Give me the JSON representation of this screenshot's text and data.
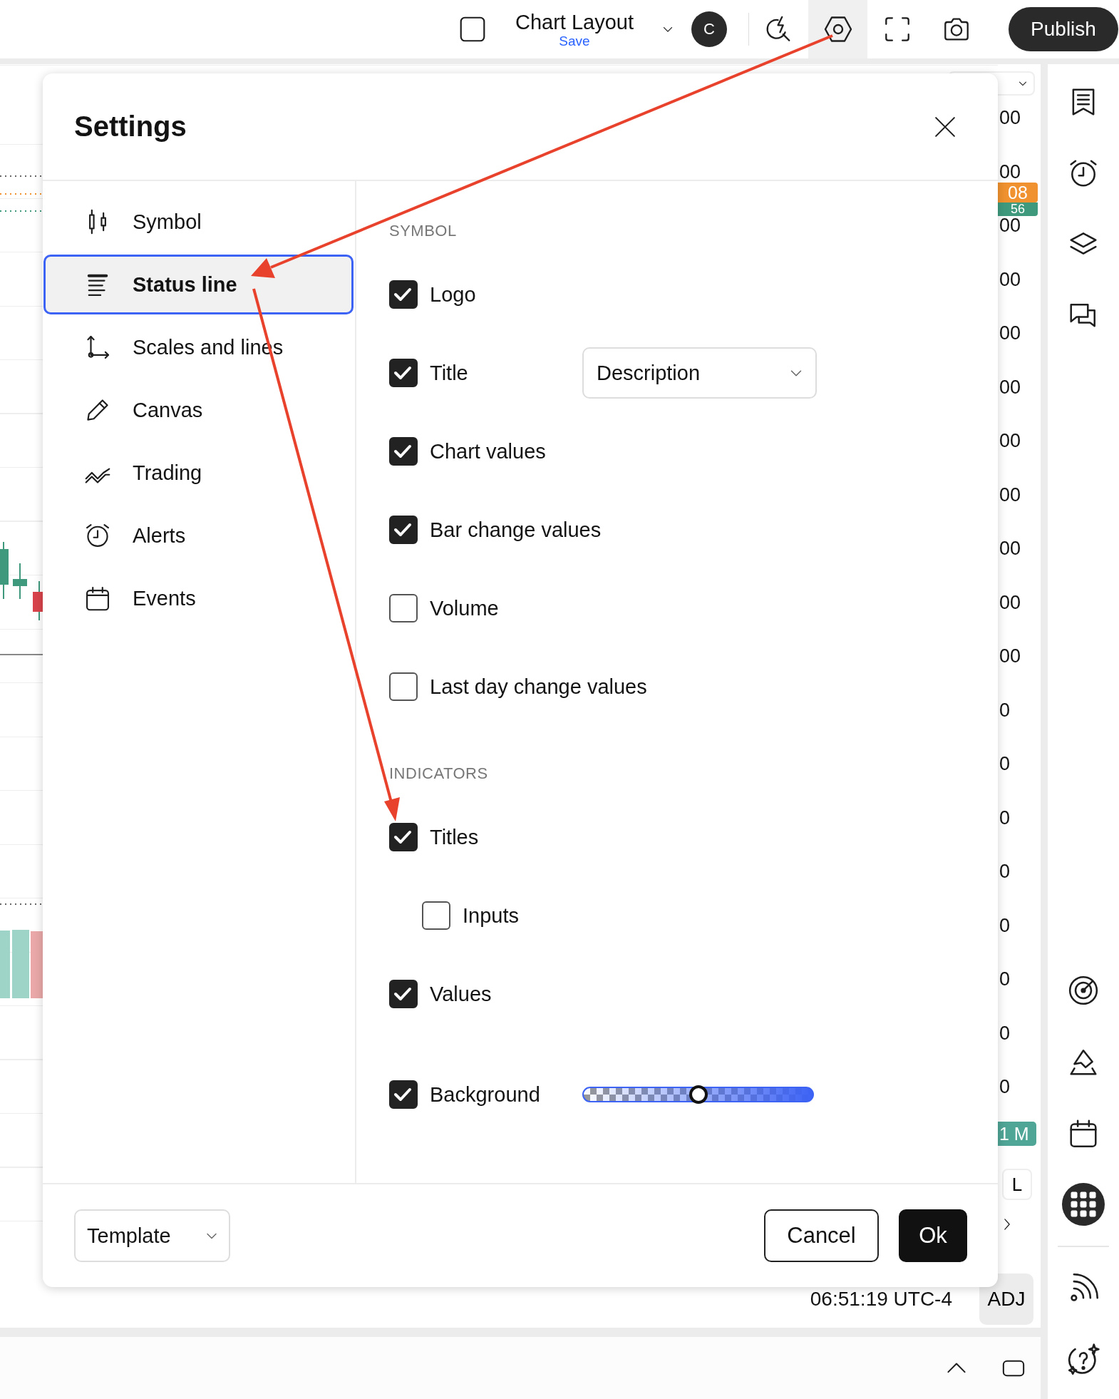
{
  "topbar": {
    "layout_name": "Chart Layout",
    "save_label": "Save",
    "avatar": "C",
    "tools": [
      {
        "selected": false
      },
      {
        "selected": true
      },
      {
        "selected": false
      },
      {
        "selected": false
      }
    ],
    "publish": "Publish"
  },
  "price_axis": {
    "labels": [
      "00",
      "00",
      "00",
      "00",
      "00",
      "00",
      "00",
      "00",
      "00",
      "00",
      "00",
      "0",
      "0",
      "0",
      "0",
      "0",
      "0",
      "0",
      "0"
    ],
    "badges": [
      {
        "text": "08",
        "color": "#f0922f"
      },
      {
        "text": "56",
        "color": "#3f9a7d"
      }
    ],
    "volume_badge": {
      "text": "1 M",
      "color": "#4fa596"
    },
    "scale_button": "L"
  },
  "status": {
    "time": "06:51:19 UTC-4",
    "adjustment": "ADJ"
  },
  "dialog": {
    "title": "Settings",
    "nav": [
      {
        "label": "Symbol",
        "selected": false
      },
      {
        "label": "Status line",
        "selected": true
      },
      {
        "label": "Scales and lines",
        "selected": false
      },
      {
        "label": "Canvas",
        "selected": false
      },
      {
        "label": "Trading",
        "selected": false
      },
      {
        "label": "Alerts",
        "selected": false
      },
      {
        "label": "Events",
        "selected": false
      }
    ],
    "sections": [
      {
        "heading": "SYMBOL",
        "options": [
          {
            "kind": "checkbox",
            "label": "Logo",
            "checked": true
          },
          {
            "kind": "select",
            "label": "Title",
            "checked": true,
            "value": "Description"
          },
          {
            "kind": "checkbox",
            "label": "Chart values",
            "checked": true
          },
          {
            "kind": "checkbox",
            "label": "Bar change values",
            "checked": true
          },
          {
            "kind": "checkbox",
            "label": "Volume",
            "checked": false
          },
          {
            "kind": "checkbox",
            "label": "Last day change values",
            "checked": false
          }
        ]
      },
      {
        "heading": "INDICATORS",
        "options": [
          {
            "kind": "checkbox",
            "label": "Titles",
            "checked": true,
            "children": [
              {
                "label": "Inputs",
                "checked": false
              }
            ]
          },
          {
            "kind": "checkbox",
            "label": "Values",
            "checked": true
          },
          {
            "kind": "slider",
            "label": "Background",
            "checked": true,
            "level": 0.5
          }
        ]
      }
    ],
    "template": "Template",
    "buttons": [
      {
        "label": "Cancel",
        "kind": "secondary"
      },
      {
        "label": "Ok",
        "kind": "primary"
      }
    ]
  }
}
